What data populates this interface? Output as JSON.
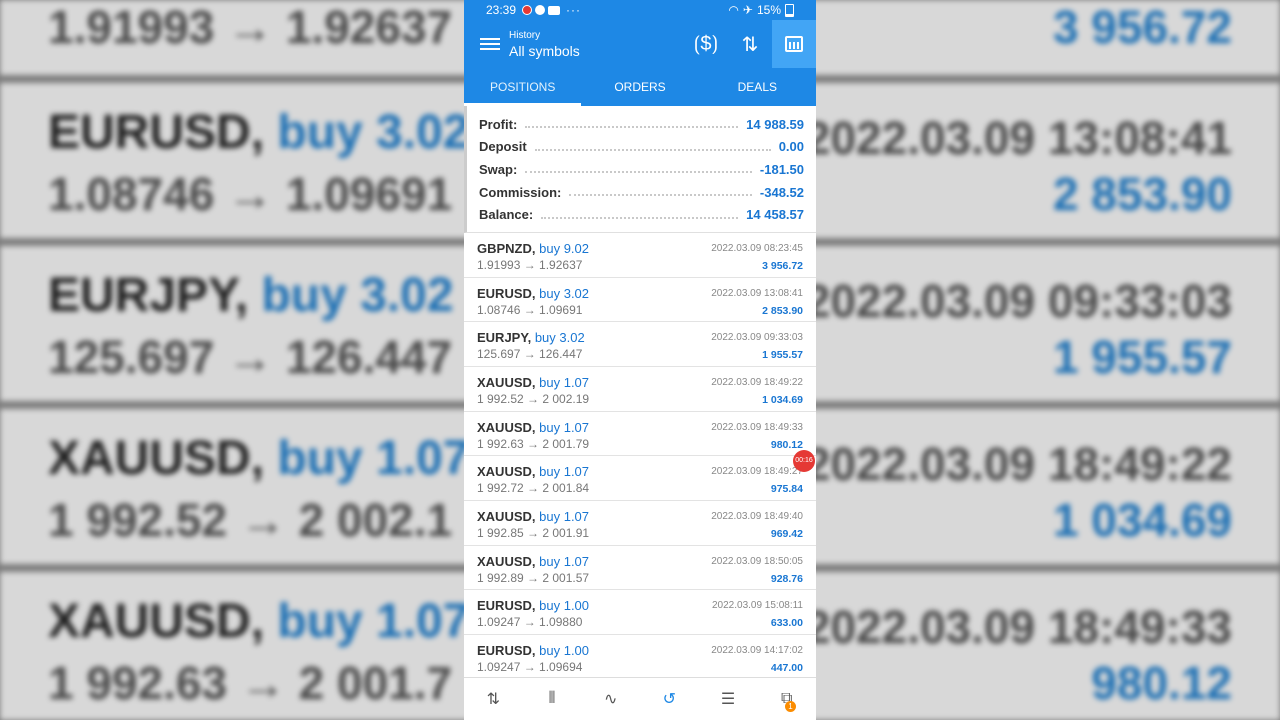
{
  "status": {
    "time": "23:39",
    "dots": "···",
    "battery": "15%"
  },
  "appbar": {
    "subtitle": "History",
    "title": "All symbols"
  },
  "tabs": [
    {
      "label": "POSITIONS"
    },
    {
      "label": "ORDERS"
    },
    {
      "label": "DEALS"
    }
  ],
  "summary": [
    {
      "label": "Profit:",
      "value": "14 988.59"
    },
    {
      "label": "Deposit",
      "value": "0.00"
    },
    {
      "label": "Swap:",
      "value": "-181.50"
    },
    {
      "label": "Commission:",
      "value": "-348.52"
    },
    {
      "label": "Balance:",
      "value": "14 458.57"
    }
  ],
  "positions": [
    {
      "symbol": "GBPNZD,",
      "side": "buy 9.02",
      "prices": "1.91993 → 1.92637",
      "time": "2022.03.09 08:23:45",
      "profit": "3 956.72"
    },
    {
      "symbol": "EURUSD,",
      "side": "buy 3.02",
      "prices": "1.08746 → 1.09691",
      "time": "2022.03.09 13:08:41",
      "profit": "2 853.90"
    },
    {
      "symbol": "EURJPY,",
      "side": "buy 3.02",
      "prices": "125.697 → 126.447",
      "time": "2022.03.09 09:33:03",
      "profit": "1 955.57"
    },
    {
      "symbol": "XAUUSD,",
      "side": "buy 1.07",
      "prices": "1 992.52 → 2 002.19",
      "time": "2022.03.09 18:49:22",
      "profit": "1 034.69"
    },
    {
      "symbol": "XAUUSD,",
      "side": "buy 1.07",
      "prices": "1 992.63 → 2 001.79",
      "time": "2022.03.09 18:49:33",
      "profit": "980.12"
    },
    {
      "symbol": "XAUUSD,",
      "side": "buy 1.07",
      "prices": "1 992.72 → 2 001.84",
      "time": "2022.03.09 18:49:27",
      "profit": "975.84"
    },
    {
      "symbol": "XAUUSD,",
      "side": "buy 1.07",
      "prices": "1 992.85 → 2 001.91",
      "time": "2022.03.09 18:49:40",
      "profit": "969.42"
    },
    {
      "symbol": "XAUUSD,",
      "side": "buy 1.07",
      "prices": "1 992.89 → 2 001.57",
      "time": "2022.03.09 18:50:05",
      "profit": "928.76"
    },
    {
      "symbol": "EURUSD,",
      "side": "buy 1.00",
      "prices": "1.09247 → 1.09880",
      "time": "2022.03.09 15:08:11",
      "profit": "633.00"
    },
    {
      "symbol": "EURUSD,",
      "side": "buy 1.00",
      "prices": "1.09247 → 1.09694",
      "time": "2022.03.09 14:17:02",
      "profit": "447.00"
    }
  ],
  "recording_badge": "00:16",
  "nav": [
    {
      "icon": "quotes-icon",
      "glyph": "⇅"
    },
    {
      "icon": "chart-icon",
      "glyph": "⫴"
    },
    {
      "icon": "trade-icon",
      "glyph": "∿"
    },
    {
      "icon": "history-icon",
      "glyph": "↺"
    },
    {
      "icon": "journal-icon",
      "glyph": "☰"
    },
    {
      "icon": "messages-icon",
      "glyph": "⧉",
      "badge": "1"
    }
  ],
  "background": {
    "rows": [
      {
        "line1": "",
        "line1_side": "",
        "line2": "1.91993 → 1.92637",
        "right1": "",
        "right2": "3 956.72"
      },
      {
        "line1": "EURUSD,",
        "line1_side": "buy 3.02",
        "line2": "1.08746 → 1.09691",
        "right1": "2022.03.09 13:08:41",
        "right2": "2 853.90"
      },
      {
        "line1": "EURJPY,",
        "line1_side": "buy 3.02",
        "line2": "125.697 → 126.447",
        "right1": "2022.03.09 09:33:03",
        "right2": "1 955.57"
      },
      {
        "line1": "XAUUSD,",
        "line1_side": "buy 1.07",
        "line2": "1 992.52 → 2 002.1",
        "right1": "2022.03.09 18:49:22",
        "right2": "1 034.69"
      },
      {
        "line1": "XAUUSD,",
        "line1_side": "buy 1.07",
        "line2": "1 992.63 → 2 001.7",
        "right1": "2022.03.09 18:49:33",
        "right2": "980.12"
      }
    ]
  }
}
